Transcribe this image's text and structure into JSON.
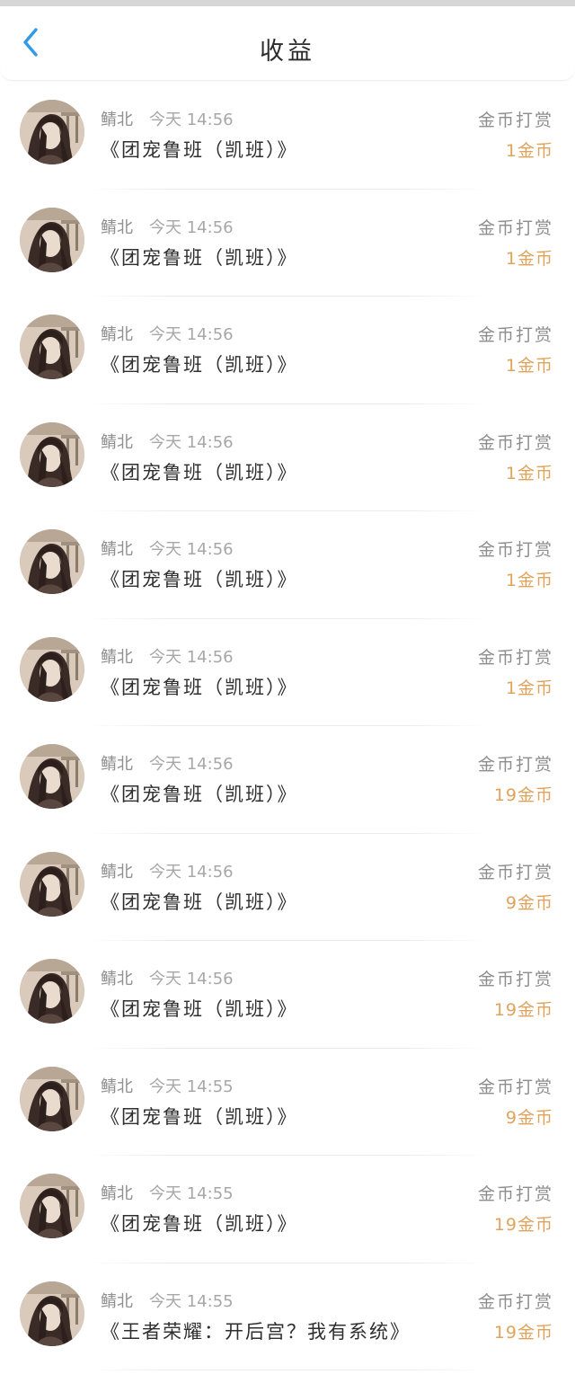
{
  "header": {
    "title": "收益",
    "back_icon": "chevron-left-icon",
    "accent_color": "#2e9be6"
  },
  "colors": {
    "amount": "#e0a35e",
    "muted_text": "#9a9a9a"
  },
  "items": [
    {
      "user": "鲭北",
      "time": "今天 14:56",
      "book": "《团宠鲁班（凯班）》",
      "type": "金币打赏",
      "amount": "1金币"
    },
    {
      "user": "鲭北",
      "time": "今天 14:56",
      "book": "《团宠鲁班（凯班）》",
      "type": "金币打赏",
      "amount": "1金币"
    },
    {
      "user": "鲭北",
      "time": "今天 14:56",
      "book": "《团宠鲁班（凯班）》",
      "type": "金币打赏",
      "amount": "1金币"
    },
    {
      "user": "鲭北",
      "time": "今天 14:56",
      "book": "《团宠鲁班（凯班）》",
      "type": "金币打赏",
      "amount": "1金币"
    },
    {
      "user": "鲭北",
      "time": "今天 14:56",
      "book": "《团宠鲁班（凯班）》",
      "type": "金币打赏",
      "amount": "1金币"
    },
    {
      "user": "鲭北",
      "time": "今天 14:56",
      "book": "《团宠鲁班（凯班）》",
      "type": "金币打赏",
      "amount": "1金币"
    },
    {
      "user": "鲭北",
      "time": "今天 14:56",
      "book": "《团宠鲁班（凯班）》",
      "type": "金币打赏",
      "amount": "19金币"
    },
    {
      "user": "鲭北",
      "time": "今天 14:56",
      "book": "《团宠鲁班（凯班）》",
      "type": "金币打赏",
      "amount": "9金币"
    },
    {
      "user": "鲭北",
      "time": "今天 14:56",
      "book": "《团宠鲁班（凯班）》",
      "type": "金币打赏",
      "amount": "19金币"
    },
    {
      "user": "鲭北",
      "time": "今天 14:55",
      "book": "《团宠鲁班（凯班）》",
      "type": "金币打赏",
      "amount": "9金币"
    },
    {
      "user": "鲭北",
      "time": "今天 14:55",
      "book": "《团宠鲁班（凯班）》",
      "type": "金币打赏",
      "amount": "19金币"
    },
    {
      "user": "鲭北",
      "time": "今天 14:55",
      "book": "《王者荣耀：开后宫？我有系统》",
      "type": "金币打赏",
      "amount": "19金币"
    }
  ]
}
